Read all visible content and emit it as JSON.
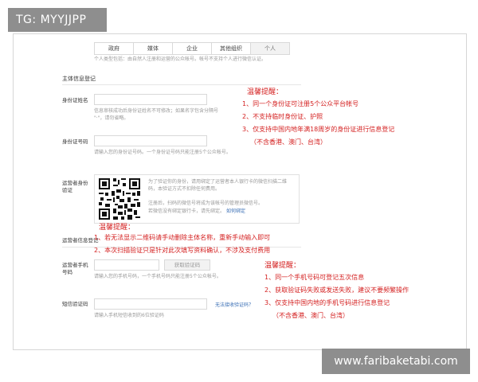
{
  "tag": "TG: MYYJJPP",
  "site": "www.faribaketabi.com",
  "tabs": [
    {
      "label": "政府",
      "active": false
    },
    {
      "label": "媒体",
      "active": false
    },
    {
      "label": "企业",
      "active": false
    },
    {
      "label": "其他组织",
      "active": false
    },
    {
      "label": "个人",
      "active": true
    }
  ],
  "type_hint": "个人类型包括：由自然人注册和运营的公众帐号。帐号不支持个人进行微信认证。",
  "section_title": "主体信息登记",
  "id_name": {
    "label": "身份证姓名",
    "hint": "信息审核成功后身份证姓名不可修改；如果名字包含分隔号 \"·\"，请勿省略。"
  },
  "id_number": {
    "label": "身份证号码",
    "hint": "请输入您的身份证号码。一个身份证号码只能注册5个公众帐号。"
  },
  "operator_verify": {
    "label_line1": "运营者身份",
    "label_line2": "验证",
    "desc": "为了验证你的身份，请用绑定了运营者本人银行卡的微信扫描二维码，本验证方式不扣除任何费用。",
    "note": "注册后，扫码的微信号将成为该帐号的管理员微信号。",
    "note_link": "管理员微信号",
    "note2": "若微信没有绑定银行卡，请先绑定。",
    "note2_link": "如何绑定"
  },
  "operator_info_label": "运营者信息登记",
  "phone": {
    "label_line1": "运营者手机",
    "label_line2": "号码",
    "button": "获取验证码",
    "hint": "请输入您的手机号码，一个手机号码只能注册5个公众帐号。"
  },
  "sms": {
    "label": "短信验证码",
    "link": "无法接收验证码？",
    "hint": "请输入手机短信收到的6位验证码"
  },
  "warning1": {
    "title": "温馨提醒：",
    "lines": [
      "1、同一个身份证可注册5个公众平台帐号",
      "2、不支持临时身份证、护照",
      "3、仅支持中国内地年满18周岁的身份证进行信息登记",
      "（不含香港、澳门、台湾）"
    ]
  },
  "warning2": {
    "title": "温馨提醒：",
    "lines": [
      "1、若无法显示二维码请手动删除主体名称，重新手动输入即可",
      "2、本次扫描验证只是针对此次填写资料确认，不涉及支付费用"
    ]
  },
  "warning3": {
    "title": "温馨提醒：",
    "lines": [
      "1、同一个手机号码可登记五次信息",
      "2、获取验证码失败或发送失败，建议不要频繁操作",
      "3、仅支持中国内地的手机号码进行信息登记",
      "（不含香港、澳门、台湾）"
    ]
  }
}
